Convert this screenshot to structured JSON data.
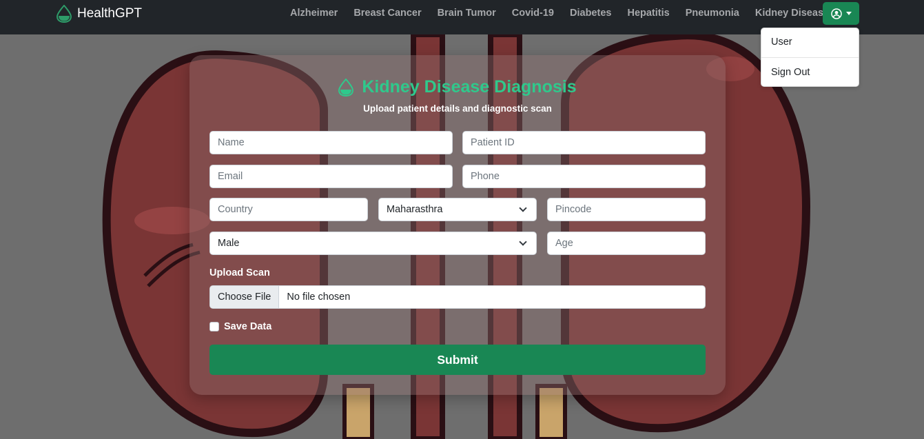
{
  "brand": {
    "name": "HealthGPT",
    "icon": "drop-icon"
  },
  "nav": {
    "links": [
      "Alzheimer",
      "Breast Cancer",
      "Brain Tumor",
      "Covid-19",
      "Diabetes",
      "Hepatitis",
      "Pneumonia",
      "Kidney Disease"
    ],
    "user_icon": "user-circle-icon"
  },
  "dropdown": {
    "items": [
      "User",
      "Sign Out"
    ]
  },
  "form": {
    "title": "Kidney Disease Diagnosis",
    "subtitle": "Upload patient details and diagnostic scan",
    "placeholders": {
      "name": "Name",
      "patient_id": "Patient ID",
      "email": "Email",
      "phone": "Phone",
      "country": "Country",
      "pincode": "Pincode",
      "age": "Age"
    },
    "state_value": "Maharasthra",
    "gender_value": "Male",
    "upload_label": "Upload Scan",
    "choose_file": "Choose File",
    "no_file": "No file chosen",
    "save_label": "Save Data",
    "submit_label": "Submit"
  },
  "colors": {
    "accent": "#198754",
    "title": "#2fc98c",
    "navbar": "#212529"
  }
}
